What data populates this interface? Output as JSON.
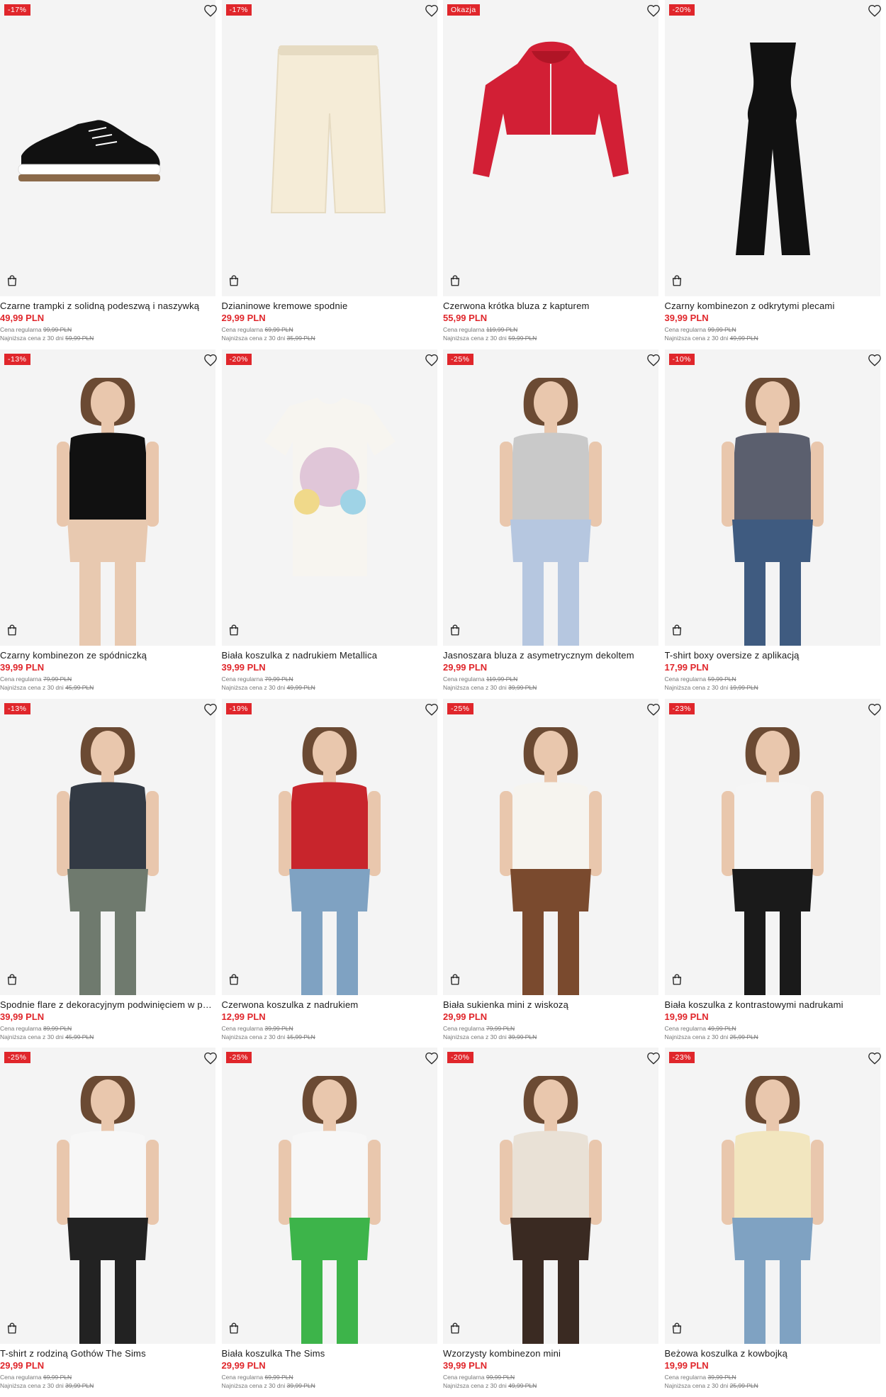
{
  "labels": {
    "regular_prefix": "Cena regularna",
    "lowest_prefix": "Najniższa cena z 30 dni"
  },
  "colors": {
    "accent": "#e0262b",
    "image_bg": "#f4f4f4"
  },
  "icons": {
    "favorite": "heart-icon",
    "cart": "shopping-bag-icon"
  },
  "products": [
    {
      "badge": "-17%",
      "name": "Czarne trampki z solidną podeszwą i naszywką",
      "price": "49,99 PLN",
      "regular": "99,99 PLN",
      "lowest": "59,99 PLN",
      "image": "black-sneaker",
      "colors": [
        "#111111",
        "#ffffff"
      ]
    },
    {
      "badge": "-17%",
      "name": "Dzianinowe kremowe spodnie",
      "price": "29,99 PLN",
      "regular": "69,99 PLN",
      "lowest": "35,99 PLN",
      "image": "cream-pants",
      "colors": [
        "#f5ecd7",
        "#e6dbc2"
      ]
    },
    {
      "badge": "Okazja",
      "name": "Czerwona krótka bluza z kapturem",
      "price": "55,99 PLN",
      "regular": "119,99 PLN",
      "lowest": "59,99 PLN",
      "image": "red-hoodie",
      "colors": [
        "#d21f35",
        "#b01526"
      ]
    },
    {
      "badge": "-20%",
      "name": "Czarny kombinezon z odkrytymi plecami",
      "price": "39,99 PLN",
      "regular": "99,99 PLN",
      "lowest": "49,99 PLN",
      "image": "black-jumpsuit",
      "colors": [
        "#111111",
        "#222222"
      ]
    },
    {
      "badge": "-13%",
      "name": "Czarny kombinezon ze spódniczką",
      "price": "39,99 PLN",
      "regular": "79,99 PLN",
      "lowest": "45,99 PLN",
      "image": "model-black-dress",
      "colors": [
        "#111111",
        "#e8c9b0"
      ]
    },
    {
      "badge": "-20%",
      "name": "Biała koszulka z nadrukiem Metallica",
      "price": "39,99 PLN",
      "regular": "79,99 PLN",
      "lowest": "49,99 PLN",
      "image": "white-tee-print",
      "colors": [
        "#f7f5f0",
        "#e0c6d8"
      ]
    },
    {
      "badge": "-25%",
      "name": "Jasnoszara bluza z asymetrycznym dekoltem",
      "price": "29,99 PLN",
      "regular": "119,99 PLN",
      "lowest": "39,99 PLN",
      "image": "model-grey-sweat",
      "colors": [
        "#c9c9c9",
        "#b6c7e0"
      ]
    },
    {
      "badge": "-10%",
      "name": "T-shirt boxy oversize z aplikacją",
      "price": "17,99 PLN",
      "regular": "59,99 PLN",
      "lowest": "19,99 PLN",
      "image": "model-grey-crop",
      "colors": [
        "#5b5f6e",
        "#3f5b80"
      ]
    },
    {
      "badge": "-13%",
      "name": "Spodnie flare z dekoracyjnym podwinięciem w pasie",
      "price": "39,99 PLN",
      "regular": "89,99 PLN",
      "lowest": "45,99 PLN",
      "image": "model-flare-pants",
      "colors": [
        "#333a44",
        "#6f7a6e"
      ]
    },
    {
      "badge": "-19%",
      "name": "Czerwona koszulka z nadrukiem",
      "price": "12,99 PLN",
      "regular": "39,99 PLN",
      "lowest": "15,99 PLN",
      "image": "model-red-tee",
      "colors": [
        "#c8252c",
        "#7fa2c2"
      ]
    },
    {
      "badge": "-25%",
      "name": "Biała sukienka mini z wiskozą",
      "price": "29,99 PLN",
      "regular": "79,99 PLN",
      "lowest": "39,99 PLN",
      "image": "model-white-dress",
      "colors": [
        "#f6f4ef",
        "#7a4a2e"
      ]
    },
    {
      "badge": "-23%",
      "name": "Biała koszulka z kontrastowymi nadrukami",
      "price": "19,99 PLN",
      "regular": "49,99 PLN",
      "lowest": "25,99 PLN",
      "image": "model-raglan-tee",
      "colors": [
        "#f5f5f5",
        "#1a1a1a"
      ]
    },
    {
      "badge": "-25%",
      "name": "T-shirt z rodziną Gothów The Sims",
      "price": "29,99 PLN",
      "regular": "69,99 PLN",
      "lowest": "39,99 PLN",
      "image": "model-goth-tee",
      "colors": [
        "#f7f7f7",
        "#222222"
      ]
    },
    {
      "badge": "-25%",
      "name": "Biała koszulka The Sims",
      "price": "29,99 PLN",
      "regular": "69,99 PLN",
      "lowest": "39,99 PLN",
      "image": "model-sims-tee",
      "colors": [
        "#f7f7f7",
        "#3db44a"
      ]
    },
    {
      "badge": "-20%",
      "name": "Wzorzysty kombinezon mini",
      "price": "39,99 PLN",
      "regular": "99,99 PLN",
      "lowest": "49,99 PLN",
      "image": "model-cow-dress",
      "colors": [
        "#e9e1d6",
        "#3a2a22"
      ]
    },
    {
      "badge": "-23%",
      "name": "Beżowa koszulka z kowbojką",
      "price": "19,99 PLN",
      "regular": "39,99 PLN",
      "lowest": "25,99 PLN",
      "image": "model-beige-tee",
      "colors": [
        "#f2e6bf",
        "#7fa2c2"
      ]
    }
  ]
}
